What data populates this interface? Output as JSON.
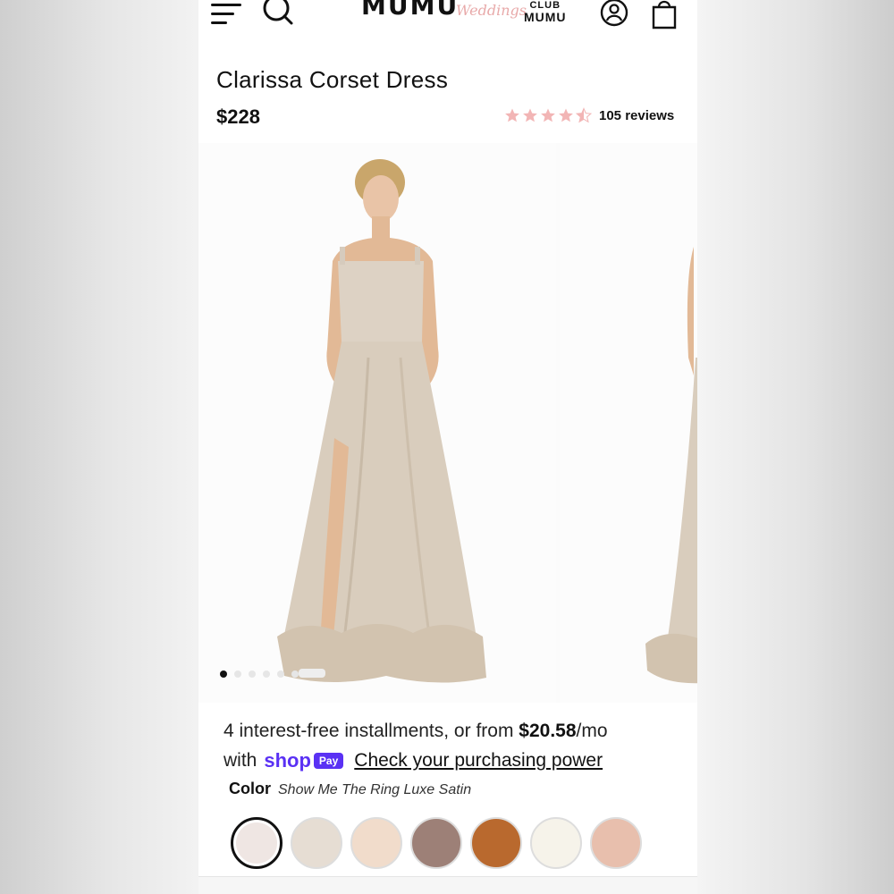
{
  "header": {
    "logo_main": "MUMU",
    "logo_script": "Weddings",
    "club_top": "CLUB",
    "club_bottom": "MUMU"
  },
  "product": {
    "title": "Clarissa Corset Dress",
    "price": "$228",
    "rating": 4.5,
    "reviews": "105 reviews"
  },
  "gallery": {
    "slide_count": 6,
    "active_index": 0
  },
  "payment": {
    "installments_prefix": "4 interest-free installments, or from ",
    "installment_amount": "$20.58",
    "installments_suffix": "/mo",
    "with_text": "with",
    "shop_word": "shop",
    "pay_badge": "Pay",
    "check_link": "Check your purchasing power"
  },
  "color": {
    "label": "Color",
    "selected_name": "Show Me The Ring Luxe Satin",
    "swatches": [
      "#efe6e3",
      "#e6ddd3",
      "#f1dccb",
      "#9d8077",
      "#b9692e",
      "#f6f3ea",
      "#e8bfad"
    ]
  },
  "icons": [
    "menu-icon",
    "search-icon",
    "account-icon",
    "bag-icon",
    "star-icon"
  ],
  "colors": {
    "star": "#f2b5b5",
    "shop_purple": "#5a31f4",
    "logo_script": "#e8a9a9"
  }
}
